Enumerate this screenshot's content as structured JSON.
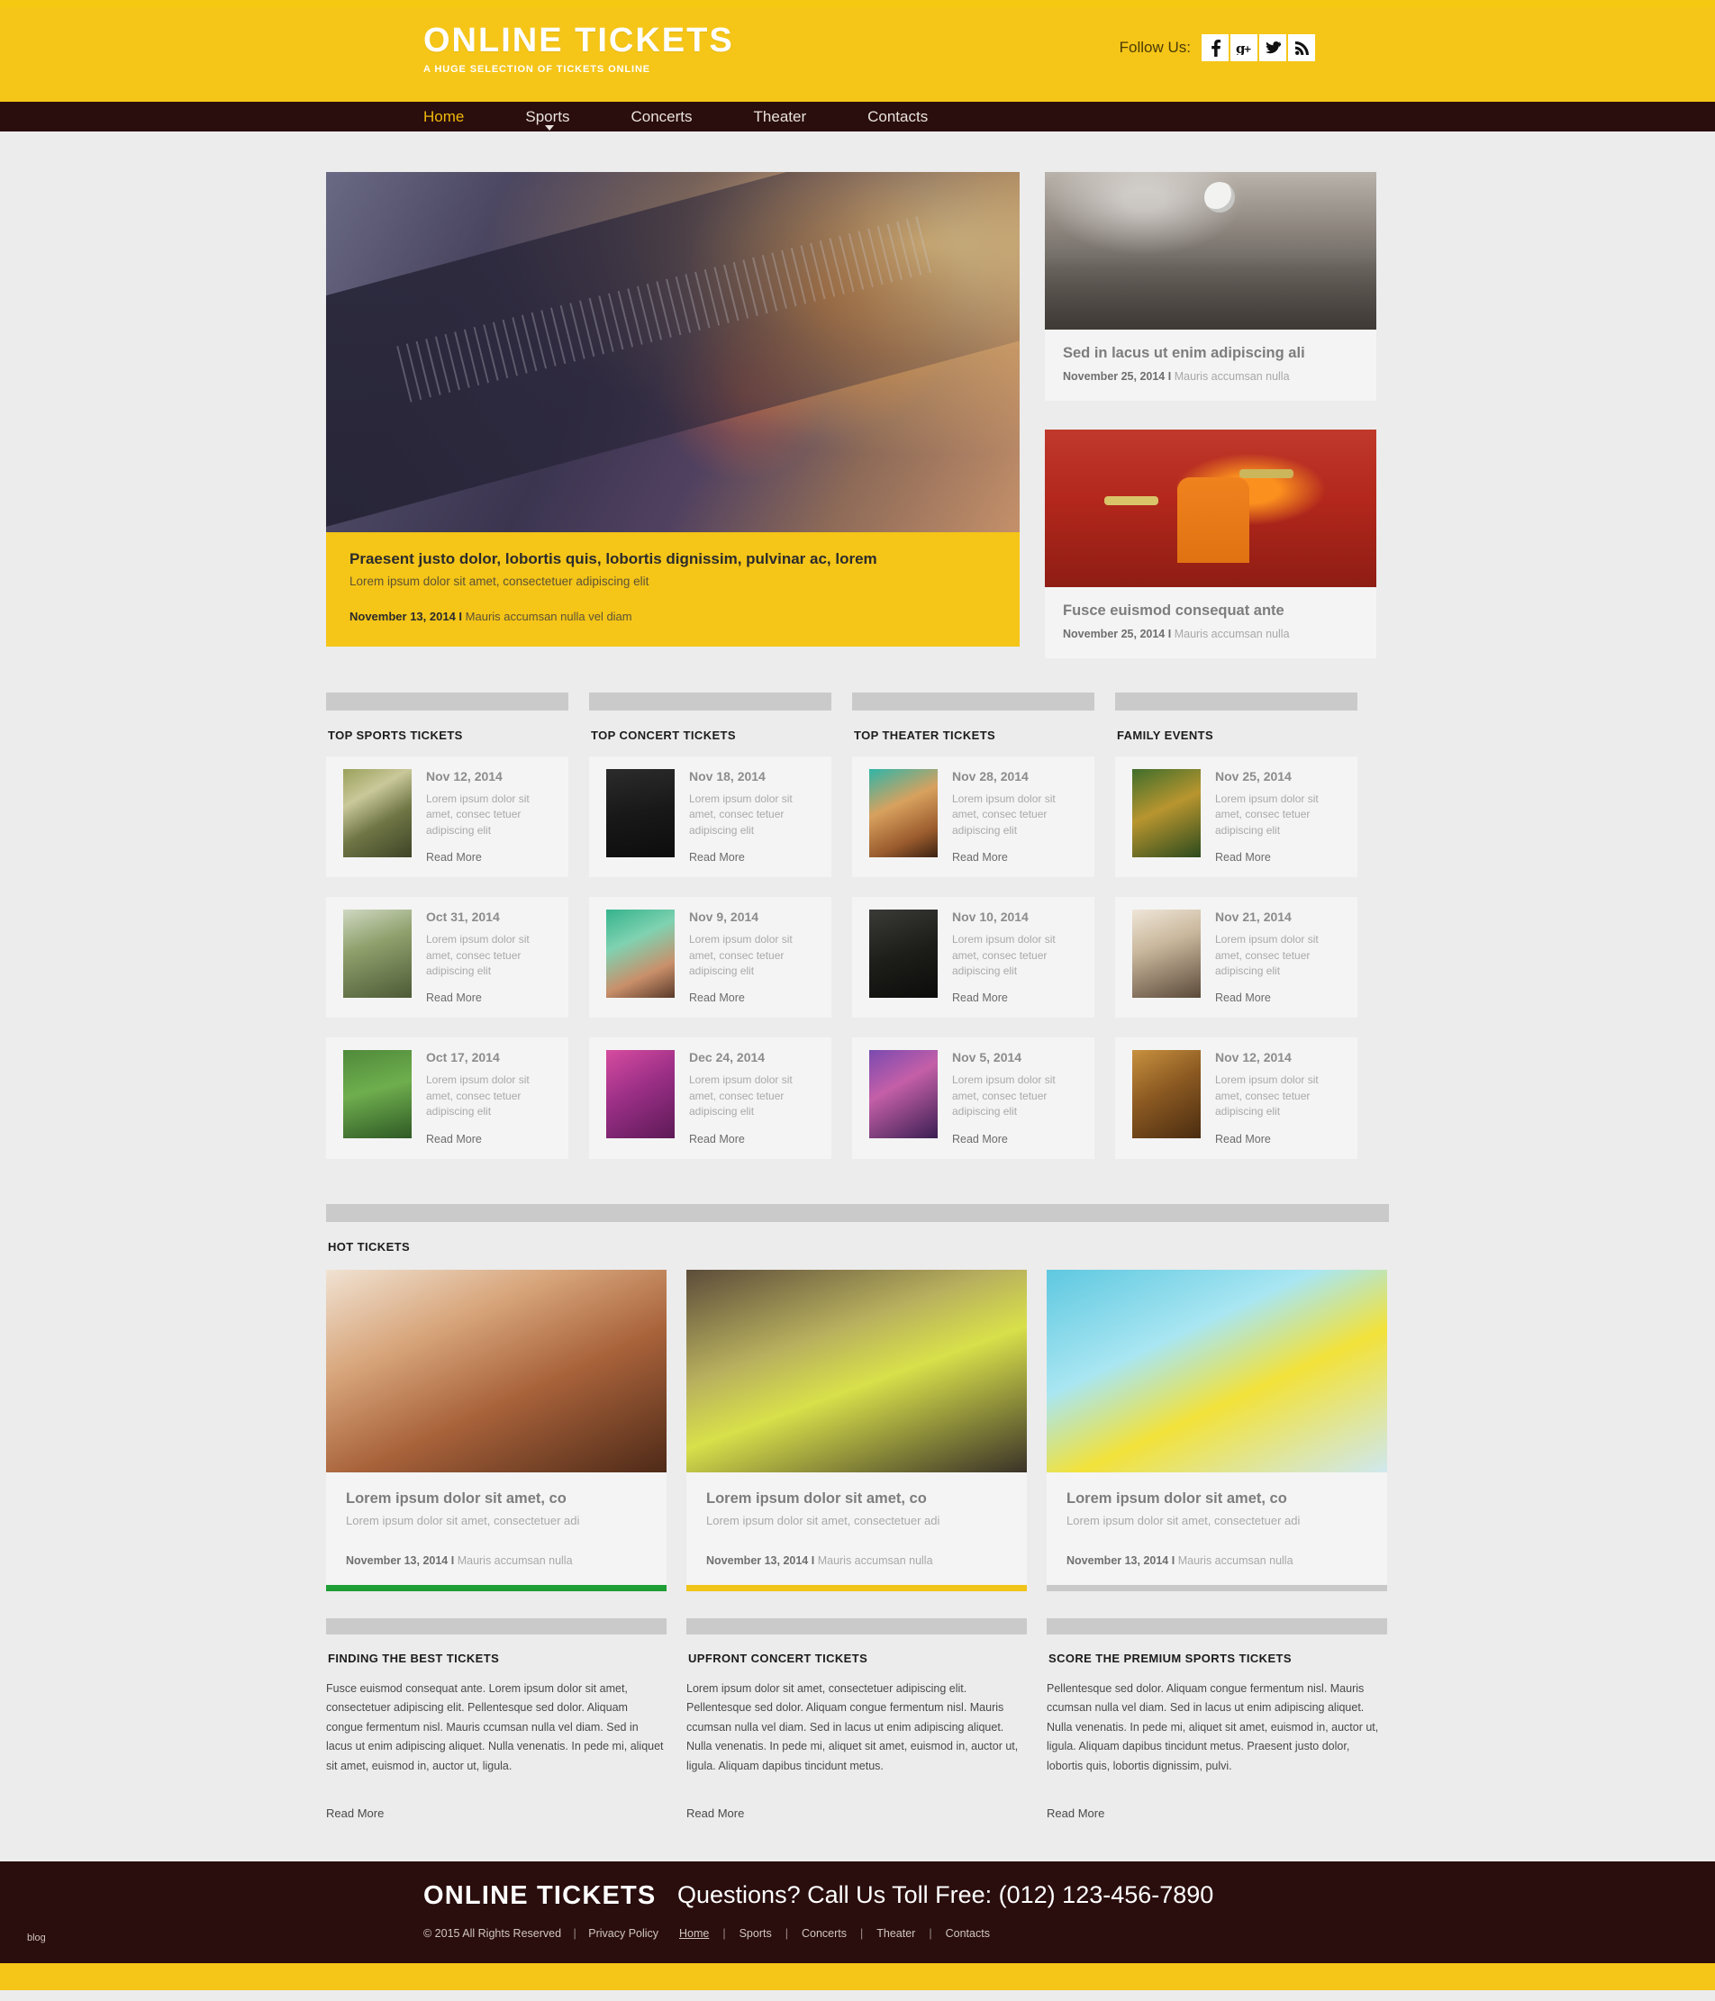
{
  "header": {
    "brand_title": "ONLINE TICKETS",
    "brand_subtitle": "A HUGE SELECTION OF TICKETS ONLINE",
    "follow_label": "Follow Us:",
    "accent_color": "#f5c518",
    "nav_bg_color": "#2a0d0d",
    "social": [
      {
        "name": "facebook-icon",
        "glyph": "f"
      },
      {
        "name": "google-plus-icon",
        "glyph": "g+"
      },
      {
        "name": "twitter-icon",
        "glyph": "t"
      },
      {
        "name": "rss-icon",
        "glyph": "rss"
      }
    ]
  },
  "nav": {
    "items": [
      {
        "label": "Home",
        "active": true,
        "dropdown": false
      },
      {
        "label": "Sports",
        "active": false,
        "dropdown": true
      },
      {
        "label": "Concerts",
        "active": false,
        "dropdown": false
      },
      {
        "label": "Theater",
        "active": false,
        "dropdown": false
      },
      {
        "label": "Contacts",
        "active": false,
        "dropdown": false
      }
    ]
  },
  "featured": {
    "title": "Praesent justo dolor, lobortis quis, lobortis dignissim, pulvinar ac, lorem",
    "subtitle": "Lorem ipsum dolor sit amet, consectetuer adipiscing elit",
    "date": "November 13, 2014 I",
    "author": "Mauris accumsan nulla vel diam"
  },
  "side_cards": [
    {
      "title": "Sed in lacus ut enim adipiscing ali",
      "date": "November 25, 2014 I",
      "author": "Mauris accumsan nulla",
      "image": "soccer-players-image"
    },
    {
      "title": "Fusce euismod consequat ante",
      "date": "November 25, 2014 I",
      "author": "Mauris accumsan nulla",
      "image": "drummer-image"
    }
  ],
  "categories": [
    {
      "title": "TOP SPORTS TICKETS",
      "items": [
        {
          "date": "Nov 12, 2014",
          "desc": "Lorem ipsum dolor sit amet, consec tetuer adipiscing elit",
          "read_more": "Read More",
          "thumb": "tennis-player-thumb"
        },
        {
          "date": "Oct 31, 2014",
          "desc": "Lorem ipsum dolor sit amet, consec tetuer adipiscing elit",
          "read_more": "Read More",
          "thumb": "tennis-serve-thumb"
        },
        {
          "date": "Oct 17, 2014",
          "desc": "Lorem ipsum dolor sit amet, consec tetuer adipiscing elit",
          "read_more": "Read More",
          "thumb": "field-player-thumb"
        }
      ]
    },
    {
      "title": "TOP CONCERT TICKETS",
      "items": [
        {
          "date": "Nov 18, 2014",
          "desc": "Lorem ipsum dolor sit amet, consec tetuer adipiscing elit",
          "read_more": "Read More",
          "thumb": "guitarist-thumb"
        },
        {
          "date": "Nov 9, 2014",
          "desc": "Lorem ipsum dolor sit amet, consec tetuer adipiscing elit",
          "read_more": "Read More",
          "thumb": "singer-thumb"
        },
        {
          "date": "Dec 24, 2014",
          "desc": "Lorem ipsum dolor sit amet, consec tetuer adipiscing elit",
          "read_more": "Read More",
          "thumb": "microphone-thumb"
        }
      ]
    },
    {
      "title": "TOP THEATER TICKETS",
      "items": [
        {
          "date": "Nov 28, 2014",
          "desc": "Lorem ipsum dolor sit amet, consec tetuer adipiscing elit",
          "read_more": "Read More",
          "thumb": "masked-woman-thumb"
        },
        {
          "date": "Nov 10, 2014",
          "desc": "Lorem ipsum dolor sit amet, consec tetuer adipiscing elit",
          "read_more": "Read More",
          "thumb": "dark-costume-thumb"
        },
        {
          "date": "Nov 5, 2014",
          "desc": "Lorem ipsum dolor sit amet, consec tetuer adipiscing elit",
          "read_more": "Read More",
          "thumb": "stage-performer-thumb"
        }
      ]
    },
    {
      "title": "FAMILY EVENTS",
      "items": [
        {
          "date": "Nov 25, 2014",
          "desc": "Lorem ipsum dolor sit amet, consec tetuer adipiscing elit",
          "read_more": "Read More",
          "thumb": "beer-festival-thumb"
        },
        {
          "date": "Nov 21, 2014",
          "desc": "Lorem ipsum dolor sit amet, consec tetuer adipiscing elit",
          "read_more": "Read More",
          "thumb": "clown-thumb"
        },
        {
          "date": "Nov 12, 2014",
          "desc": "Lorem ipsum dolor sit amet, consec tetuer adipiscing elit",
          "read_more": "Read More",
          "thumb": "theater-hall-thumb"
        }
      ]
    }
  ],
  "hot": {
    "title": "HOT TICKETS",
    "cards": [
      {
        "title": "Lorem ipsum dolor sit amet, co",
        "subtitle": "Lorem ipsum dolor sit amet, consectetuer adi",
        "date": "November 13, 2014 I",
        "author": "Mauris accumsan nulla",
        "accent_color": "#1f9e35",
        "image": "masquerade-woman-image"
      },
      {
        "title": "Lorem ipsum dolor sit amet, co",
        "subtitle": "Lorem ipsum dolor sit amet, consectetuer adi",
        "date": "November 13, 2014 I",
        "author": "Mauris accumsan nulla",
        "accent_color": "#f0c419",
        "image": "tennis-balls-image"
      },
      {
        "title": "Lorem ipsum dolor sit amet, co",
        "subtitle": "Lorem ipsum dolor sit amet, consectetuer adi",
        "date": "November 13, 2014 I",
        "author": "Mauris accumsan nulla",
        "accent_color": "#c9c9c9",
        "image": "yellow-wig-woman-image"
      }
    ]
  },
  "info_columns": [
    {
      "title": "FINDING THE BEST TICKETS",
      "text": "Fusce euismod consequat ante. Lorem ipsum dolor sit amet, consectetuer adipiscing elit. Pellentesque sed dolor. Aliquam congue fermentum nisl. Mauris ccumsan nulla vel diam. Sed in lacus ut enim adipiscing aliquet. Nulla venenatis. In pede mi, aliquet sit amet, euismod in, auctor ut, ligula.",
      "read_more": "Read More"
    },
    {
      "title": "UPFRONT CONCERT TICKETS",
      "text": "Lorem ipsum dolor sit amet, consectetuer adipiscing elit. Pellentesque sed dolor. Aliquam congue fermentum nisl. Mauris ccumsan nulla vel diam. Sed in lacus ut enim adipiscing aliquet. Nulla venenatis. In pede mi, aliquet sit amet, euismod in, auctor ut, ligula. Aliquam dapibus tincidunt metus.",
      "read_more": "Read More"
    },
    {
      "title": "SCORE THE PREMIUM SPORTS TICKETS",
      "text": "Pellentesque sed dolor. Aliquam congue fermentum nisl. Mauris ccumsan nulla vel diam. Sed in lacus ut enim adipiscing aliquet. Nulla venenatis. In pede mi, aliquet sit amet, euismod in, auctor ut, ligula. Aliquam dapibus tincidunt metus. Praesent justo dolor, lobortis quis, lobortis dignissim, pulvi.",
      "read_more": "Read More"
    }
  ],
  "footer": {
    "brand": "ONLINE TICKETS",
    "copyright": "© 2015 All Rights Reserved",
    "privacy": "Privacy Policy",
    "phone": "Questions? Call Us Toll Free: (012) 123-456-7890",
    "nav": [
      "Home",
      "Sports",
      "Concerts",
      "Theater",
      "Contacts"
    ],
    "blog_tag": "blog"
  }
}
